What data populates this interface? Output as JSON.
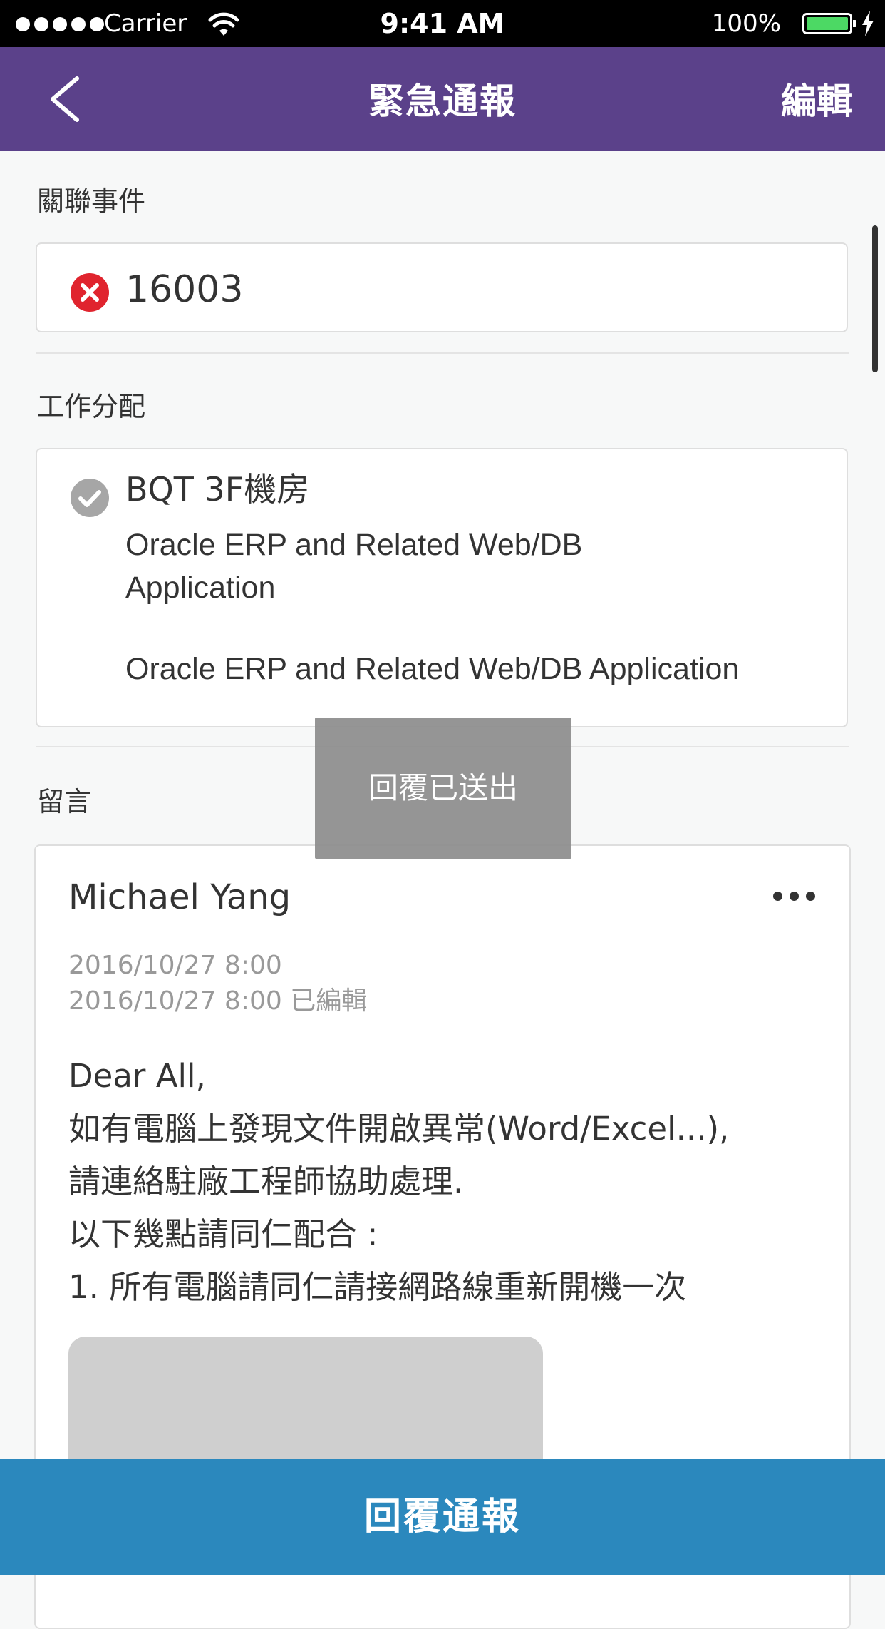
{
  "status_bar": {
    "carrier": "Carrier",
    "time": "9:41 AM",
    "battery": "100%"
  },
  "nav": {
    "title": "緊急通報",
    "edit_label": "編輯"
  },
  "related_event": {
    "label": "關聯事件",
    "id": "16003",
    "icon": "remove-icon"
  },
  "assignment": {
    "label": "工作分配",
    "location": "BQT 3F機房",
    "system_line1": "Oracle ERP and Related Web/DB Application",
    "system_line2": "Oracle ERP and Related Web/DB Application",
    "icon": "check-circle-icon"
  },
  "comments": {
    "label": "留言",
    "author": "Michael Yang",
    "posted": "2016/10/27 8:00",
    "edited": "2016/10/27 8:00 已編輯",
    "body": [
      "Dear All,",
      "如有電腦上發現文件開啟異常(Word/Excel...),",
      "請連絡駐廠工程師協助處理.",
      "以下幾點請同仁配合 :",
      "1. 所有電腦請同仁請接網路線重新開機一次"
    ]
  },
  "toast": "回覆已送出",
  "reply_button": "回覆通報",
  "colors": {
    "nav": "#5b418a",
    "button": "#2b88bd",
    "error": "#e0242e",
    "check": "#a6a6a6"
  }
}
